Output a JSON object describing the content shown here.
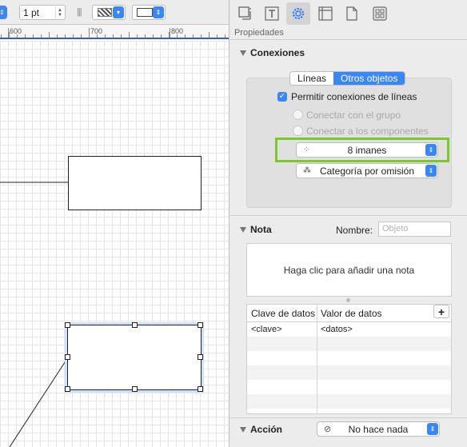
{
  "toolbar": {
    "line_width": "1 pt"
  },
  "ruler": {
    "labels": [
      "600",
      "700",
      "800"
    ]
  },
  "inspector": {
    "panel_title": "Propiedades",
    "connections": {
      "title": "Conexiones",
      "seg_lines": "Líneas",
      "seg_other": "Otros objetos",
      "allow_connections": "Permitir conexiones de líneas",
      "connect_group": "Conectar con el grupo",
      "connect_components": "Conectar a los componentes",
      "magnets": "8 imanes",
      "category": "Categoría por omisión"
    },
    "note": {
      "title": "Nota",
      "name_label": "Nombre:",
      "name_placeholder": "Objeto",
      "note_placeholder": "Haga clic para añadir una nota"
    },
    "table": {
      "headers": [
        "Clave de datos",
        "Valor de datos"
      ],
      "rows": [
        [
          "<clave>",
          "<datos>"
        ]
      ],
      "add_label": "+"
    },
    "action": {
      "title": "Acción",
      "value": "No hace nada"
    }
  }
}
